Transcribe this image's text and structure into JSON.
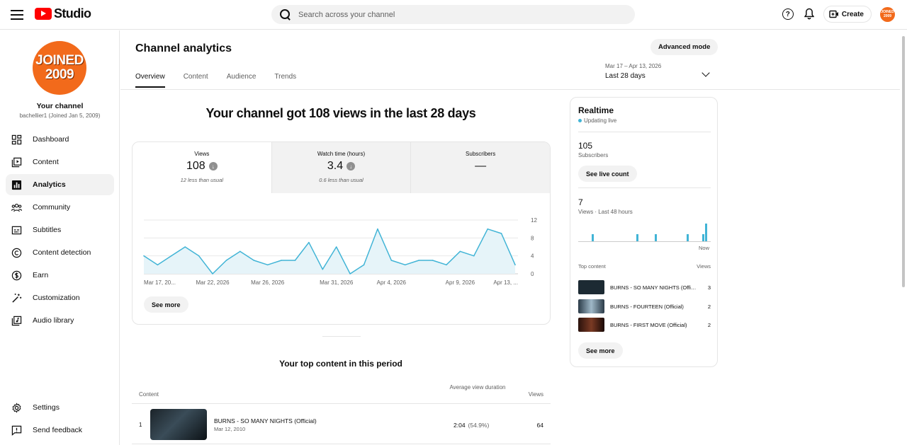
{
  "header": {
    "logo_text": "Studio",
    "search_placeholder": "Search across your channel",
    "help_glyph": "?",
    "create_label": "Create",
    "avatar_text": "JOINED 2009"
  },
  "sidebar": {
    "avatar_line1": "JOINED",
    "avatar_line2": "2009",
    "channel_title": "Your channel",
    "channel_sub": "bachellier1 (Joined Jan 5, 2009)",
    "items": [
      {
        "label": "Dashboard",
        "icon": "dashboard-icon"
      },
      {
        "label": "Content",
        "icon": "content-icon"
      },
      {
        "label": "Analytics",
        "icon": "analytics-icon",
        "active": true
      },
      {
        "label": "Community",
        "icon": "community-icon"
      },
      {
        "label": "Subtitles",
        "icon": "subtitles-icon"
      },
      {
        "label": "Content detection",
        "icon": "copyright-icon"
      },
      {
        "label": "Earn",
        "icon": "dollar-icon"
      },
      {
        "label": "Customization",
        "icon": "magic-wand-icon"
      },
      {
        "label": "Audio library",
        "icon": "audio-library-icon"
      }
    ],
    "bottom_items": [
      {
        "label": "Settings",
        "icon": "gear-icon"
      },
      {
        "label": "Send feedback",
        "icon": "feedback-icon"
      }
    ]
  },
  "main": {
    "title": "Channel analytics",
    "advanced_mode": "Advanced mode",
    "tabs": [
      "Overview",
      "Content",
      "Audience",
      "Trends"
    ],
    "date_range": "Mar 17 – Apr 13, 2026",
    "date_label": "Last 28 days",
    "headline": "Your channel got 108 views in the last 28 days",
    "metrics": [
      {
        "title": "Views",
        "value": "108",
        "note": "12 less than usual",
        "trend": "down"
      },
      {
        "title": "Watch time (hours)",
        "value": "3.4",
        "note": "0.6 less than usual",
        "trend": "down"
      },
      {
        "title": "Subscribers",
        "value": "—",
        "note": "",
        "trend": "none"
      }
    ],
    "see_more": "See more",
    "top_content_title": "Your top content in this period",
    "table": {
      "col_content": "Content",
      "col_duration": "Average view duration",
      "col_views": "Views",
      "rows": [
        {
          "rank": "1",
          "title": "BURNS - SO MANY NIGHTS (Official)",
          "date": "Mar 12, 2010",
          "duration": "2:04",
          "percent": "(54.9%)",
          "views": "64"
        }
      ]
    }
  },
  "chart_data": {
    "type": "area",
    "title": "",
    "xlabel": "",
    "ylabel": "",
    "x_tick_labels": [
      "Mar 17, 20...",
      "Mar 22, 2026",
      "Mar 26, 2026",
      "Mar 31, 2026",
      "Apr 4, 2026",
      "Apr 9, 2026",
      "Apr 13, ..."
    ],
    "x_tick_positions": [
      0,
      5,
      9,
      14,
      18,
      23,
      27
    ],
    "y_ticks": [
      0,
      4,
      8,
      12
    ],
    "ylim": [
      0,
      12
    ],
    "grid": true,
    "series": [
      {
        "name": "Views",
        "color": "#41b4d6",
        "values": [
          4,
          2,
          4,
          6,
          4,
          0,
          3,
          5,
          3,
          2,
          3,
          3,
          7,
          1,
          6,
          0,
          2,
          10,
          3,
          2,
          3,
          3,
          2,
          5,
          4,
          10,
          9,
          2
        ]
      }
    ]
  },
  "realtime": {
    "title": "Realtime",
    "updating": "Updating live",
    "subscribers_value": "105",
    "subscribers_label": "Subscribers",
    "see_live_count": "See live count",
    "views_value": "7",
    "views_label": "Views · Last 48 hours",
    "now_label": "Now",
    "top_content_label": "Top content",
    "views_col": "Views",
    "hourly_views": [
      0,
      0,
      0,
      0,
      1,
      0,
      0,
      0,
      0,
      0,
      0,
      0,
      0,
      0,
      0,
      0,
      0,
      0,
      0,
      0,
      0,
      1,
      0,
      0,
      0,
      0,
      0,
      0,
      1,
      0,
      0,
      0,
      0,
      0,
      0,
      0,
      0,
      0,
      0,
      0,
      1,
      0,
      0,
      0,
      0,
      0,
      1,
      2
    ],
    "items": [
      {
        "title": "BURNS - SO MANY NIGHTS (Official)",
        "views": "3",
        "thumb_color": "#1c2a33"
      },
      {
        "title": "BURNS - FOURTEEN (Official)",
        "views": "2",
        "thumb_color": "#6d8aa0"
      },
      {
        "title": "BURNS - FIRST MOVE (Official)",
        "views": "2",
        "thumb_color": "#3a1d14"
      }
    ],
    "see_more": "See more"
  },
  "colors": {
    "accent": "#41b4d6",
    "brand": "#ff0000",
    "avatar": "#f26a1b"
  }
}
